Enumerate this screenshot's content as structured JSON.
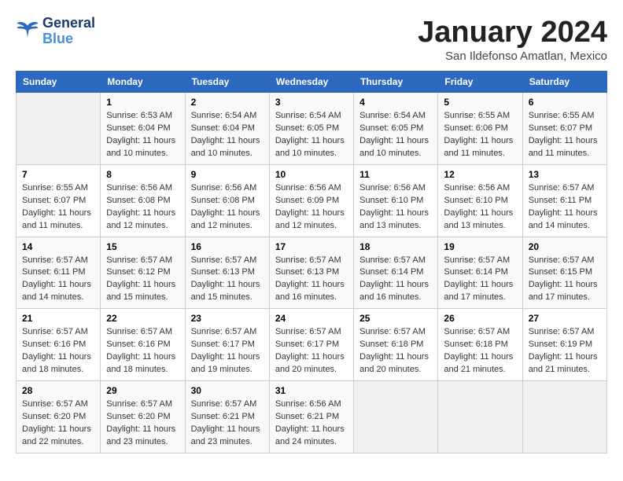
{
  "logo": {
    "line1": "General",
    "line2": "Blue"
  },
  "title": "January 2024",
  "subtitle": "San Ildefonso Amatlan, Mexico",
  "header_days": [
    "Sunday",
    "Monday",
    "Tuesday",
    "Wednesday",
    "Thursday",
    "Friday",
    "Saturday"
  ],
  "weeks": [
    [
      {
        "day": "",
        "info": ""
      },
      {
        "day": "1",
        "info": "Sunrise: 6:53 AM\nSunset: 6:04 PM\nDaylight: 11 hours and 10 minutes."
      },
      {
        "day": "2",
        "info": "Sunrise: 6:54 AM\nSunset: 6:04 PM\nDaylight: 11 hours and 10 minutes."
      },
      {
        "day": "3",
        "info": "Sunrise: 6:54 AM\nSunset: 6:05 PM\nDaylight: 11 hours and 10 minutes."
      },
      {
        "day": "4",
        "info": "Sunrise: 6:54 AM\nSunset: 6:05 PM\nDaylight: 11 hours and 10 minutes."
      },
      {
        "day": "5",
        "info": "Sunrise: 6:55 AM\nSunset: 6:06 PM\nDaylight: 11 hours and 11 minutes."
      },
      {
        "day": "6",
        "info": "Sunrise: 6:55 AM\nSunset: 6:07 PM\nDaylight: 11 hours and 11 minutes."
      }
    ],
    [
      {
        "day": "7",
        "info": "Sunrise: 6:55 AM\nSunset: 6:07 PM\nDaylight: 11 hours and 11 minutes."
      },
      {
        "day": "8",
        "info": "Sunrise: 6:56 AM\nSunset: 6:08 PM\nDaylight: 11 hours and 12 minutes."
      },
      {
        "day": "9",
        "info": "Sunrise: 6:56 AM\nSunset: 6:08 PM\nDaylight: 11 hours and 12 minutes."
      },
      {
        "day": "10",
        "info": "Sunrise: 6:56 AM\nSunset: 6:09 PM\nDaylight: 11 hours and 12 minutes."
      },
      {
        "day": "11",
        "info": "Sunrise: 6:56 AM\nSunset: 6:10 PM\nDaylight: 11 hours and 13 minutes."
      },
      {
        "day": "12",
        "info": "Sunrise: 6:56 AM\nSunset: 6:10 PM\nDaylight: 11 hours and 13 minutes."
      },
      {
        "day": "13",
        "info": "Sunrise: 6:57 AM\nSunset: 6:11 PM\nDaylight: 11 hours and 14 minutes."
      }
    ],
    [
      {
        "day": "14",
        "info": "Sunrise: 6:57 AM\nSunset: 6:11 PM\nDaylight: 11 hours and 14 minutes."
      },
      {
        "day": "15",
        "info": "Sunrise: 6:57 AM\nSunset: 6:12 PM\nDaylight: 11 hours and 15 minutes."
      },
      {
        "day": "16",
        "info": "Sunrise: 6:57 AM\nSunset: 6:13 PM\nDaylight: 11 hours and 15 minutes."
      },
      {
        "day": "17",
        "info": "Sunrise: 6:57 AM\nSunset: 6:13 PM\nDaylight: 11 hours and 16 minutes."
      },
      {
        "day": "18",
        "info": "Sunrise: 6:57 AM\nSunset: 6:14 PM\nDaylight: 11 hours and 16 minutes."
      },
      {
        "day": "19",
        "info": "Sunrise: 6:57 AM\nSunset: 6:14 PM\nDaylight: 11 hours and 17 minutes."
      },
      {
        "day": "20",
        "info": "Sunrise: 6:57 AM\nSunset: 6:15 PM\nDaylight: 11 hours and 17 minutes."
      }
    ],
    [
      {
        "day": "21",
        "info": "Sunrise: 6:57 AM\nSunset: 6:16 PM\nDaylight: 11 hours and 18 minutes."
      },
      {
        "day": "22",
        "info": "Sunrise: 6:57 AM\nSunset: 6:16 PM\nDaylight: 11 hours and 18 minutes."
      },
      {
        "day": "23",
        "info": "Sunrise: 6:57 AM\nSunset: 6:17 PM\nDaylight: 11 hours and 19 minutes."
      },
      {
        "day": "24",
        "info": "Sunrise: 6:57 AM\nSunset: 6:17 PM\nDaylight: 11 hours and 20 minutes."
      },
      {
        "day": "25",
        "info": "Sunrise: 6:57 AM\nSunset: 6:18 PM\nDaylight: 11 hours and 20 minutes."
      },
      {
        "day": "26",
        "info": "Sunrise: 6:57 AM\nSunset: 6:18 PM\nDaylight: 11 hours and 21 minutes."
      },
      {
        "day": "27",
        "info": "Sunrise: 6:57 AM\nSunset: 6:19 PM\nDaylight: 11 hours and 21 minutes."
      }
    ],
    [
      {
        "day": "28",
        "info": "Sunrise: 6:57 AM\nSunset: 6:20 PM\nDaylight: 11 hours and 22 minutes."
      },
      {
        "day": "29",
        "info": "Sunrise: 6:57 AM\nSunset: 6:20 PM\nDaylight: 11 hours and 23 minutes."
      },
      {
        "day": "30",
        "info": "Sunrise: 6:57 AM\nSunset: 6:21 PM\nDaylight: 11 hours and 23 minutes."
      },
      {
        "day": "31",
        "info": "Sunrise: 6:56 AM\nSunset: 6:21 PM\nDaylight: 11 hours and 24 minutes."
      },
      {
        "day": "",
        "info": ""
      },
      {
        "day": "",
        "info": ""
      },
      {
        "day": "",
        "info": ""
      }
    ]
  ]
}
